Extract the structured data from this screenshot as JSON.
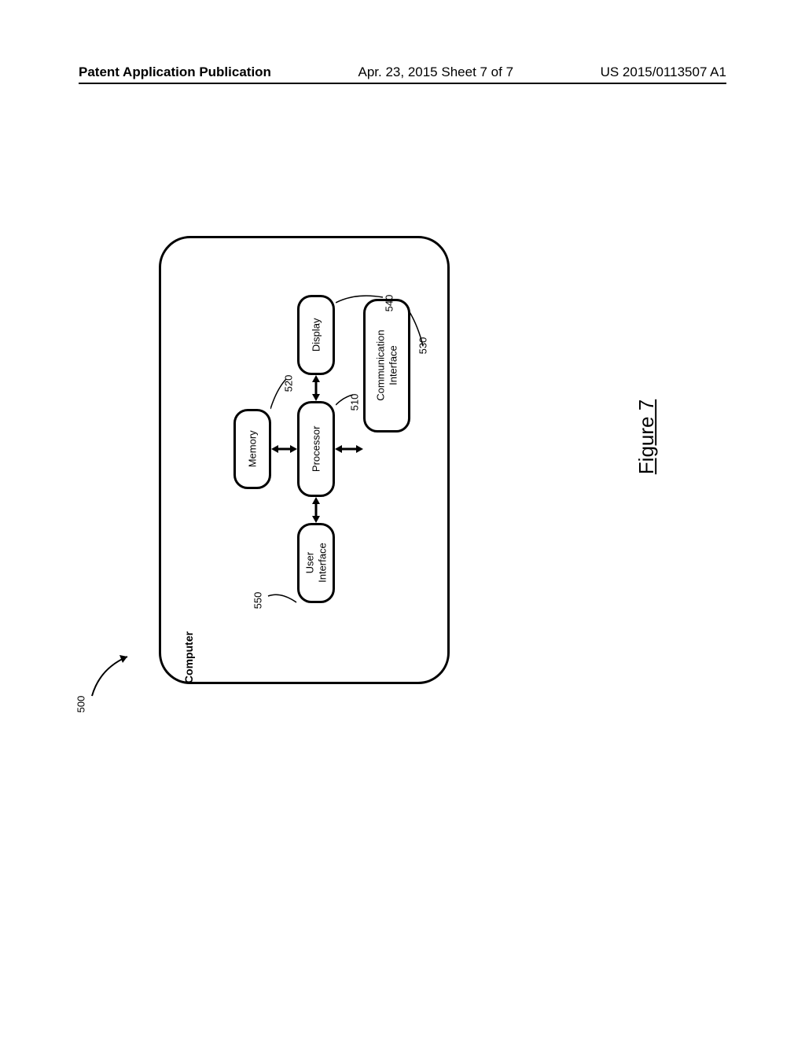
{
  "header": {
    "left": "Patent Application Publication",
    "center": "Apr. 23, 2015  Sheet 7 of 7",
    "right": "US 2015/0113507 A1"
  },
  "figure_label": "Figure 7",
  "diagram": {
    "system_ref": "500",
    "title": "Computer",
    "blocks": {
      "processor": {
        "label": "Processor",
        "ref": "510"
      },
      "memory": {
        "label": "Memory",
        "ref": "520"
      },
      "comm": {
        "label": "Communication\nInterface",
        "ref": "530"
      },
      "display": {
        "label": "Display",
        "ref": "540"
      },
      "user_interface": {
        "label": "User\nInterface",
        "ref": "550"
      }
    }
  }
}
